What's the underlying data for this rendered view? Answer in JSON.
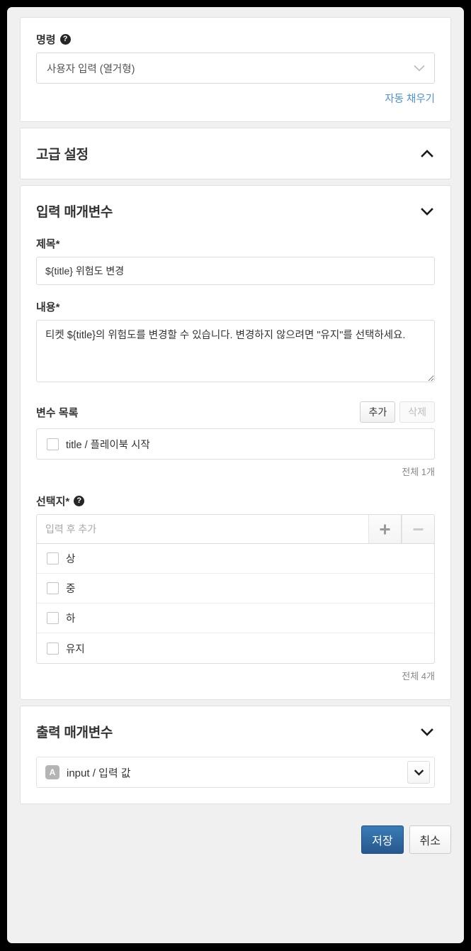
{
  "command_section": {
    "label": "명령",
    "help_icon": "help-circle-icon",
    "selected_value": "사용자 입력 (열거형)",
    "autofill_link": "자동 채우기"
  },
  "advanced_section": {
    "title": "고급 설정",
    "chevron": "chevron-up-icon"
  },
  "input_params": {
    "title": "입력 매개변수",
    "chevron": "chevron-down-icon",
    "title_field": {
      "label": "제목*",
      "value": "${title} 위험도 변경"
    },
    "content_field": {
      "label": "내용*",
      "value": "티켓 ${title}의 위험도를 변경할 수 있습니다. 변경하지 않으려면 \"유지\"를 선택하세요."
    },
    "variable_list": {
      "label": "변수 목록",
      "add_button": "추가",
      "delete_button": "삭제",
      "items": [
        {
          "label": "title / 플레이북 시작",
          "checked": false
        }
      ],
      "count_text": "전체 1개"
    },
    "choices": {
      "label": "선택지*",
      "help_icon": "help-circle-icon",
      "input_placeholder": "입력 후 추가",
      "input_value": "",
      "add_icon": "plus-icon",
      "remove_icon": "minus-icon",
      "items": [
        {
          "label": "상",
          "checked": false
        },
        {
          "label": "중",
          "checked": false
        },
        {
          "label": "하",
          "checked": false
        },
        {
          "label": "유지",
          "checked": false
        }
      ],
      "count_text": "전체 4개"
    }
  },
  "output_params": {
    "title": "출력 매개변수",
    "chevron": "chevron-down-icon",
    "rows": [
      {
        "type_badge": "A",
        "label": "input / 입력 값",
        "caret": "chevron-down-icon"
      }
    ]
  },
  "footer": {
    "save_label": "저장",
    "cancel_label": "취소"
  },
  "colors": {
    "primary": "#27588c",
    "link": "#4a90d9",
    "page_bg": "#f0f0f0",
    "card_bg": "#ffffff",
    "border": "#dddddd",
    "muted_text": "#888888"
  }
}
